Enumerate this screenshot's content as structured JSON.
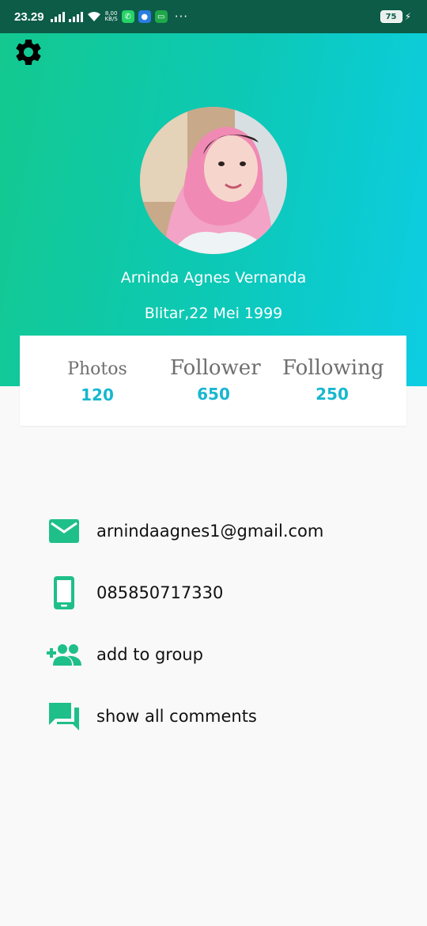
{
  "status_bar": {
    "time": "23.29",
    "net_speed_top": "8,00",
    "net_speed_bottom": "KB/S",
    "more": "···",
    "battery": "75"
  },
  "profile": {
    "name": "Arninda Agnes Vernanda",
    "birth": "Blitar,22 Mei 1999"
  },
  "stats": {
    "photos_label": "Photos",
    "photos_value": "120",
    "follower_label": "Follower",
    "follower_value": "650",
    "following_label": "Following",
    "following_value": "250"
  },
  "contact": {
    "email": "arnindaagnes1@gmail.com",
    "phone": "085850717330",
    "add_group": "add to group",
    "comments": "show all comments"
  },
  "colors": {
    "gradient_start": "#13c98f",
    "gradient_end": "#0dcde4",
    "accent": "#17b7cf",
    "icon": "#1fbf8a",
    "status_bar": "#0c5c48"
  }
}
